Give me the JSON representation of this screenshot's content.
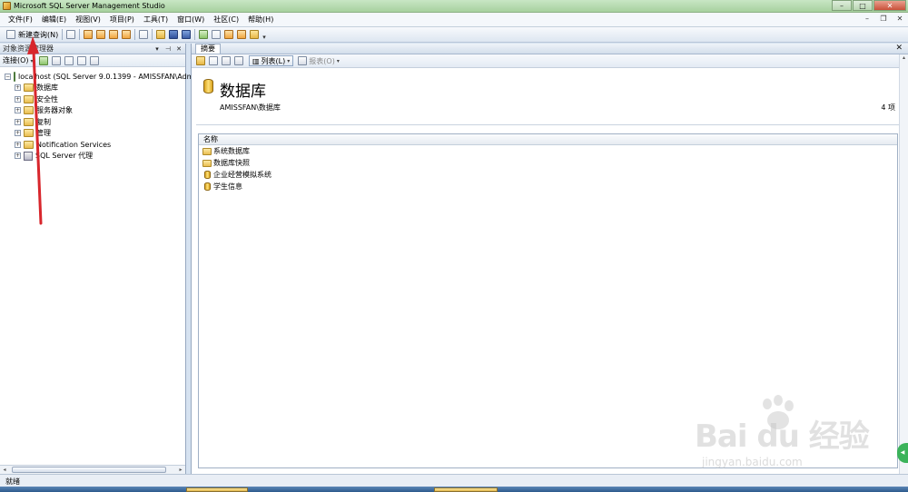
{
  "window": {
    "title": "Microsoft SQL Server Management Studio"
  },
  "menu": {
    "items": [
      "文件(F)",
      "编辑(E)",
      "视图(V)",
      "项目(P)",
      "工具(T)",
      "窗口(W)",
      "社区(C)",
      "帮助(H)"
    ]
  },
  "toolbar": {
    "new_query_label": "新建查询(N)"
  },
  "object_explorer": {
    "title": "对象资源管理器",
    "connect_label": "连接(O)",
    "root": {
      "label": "localhost (SQL Server 9.0.1399 - AMISSFAN\\Adm"
    },
    "nodes": [
      {
        "label": "数据库",
        "icon": "folder-icon"
      },
      {
        "label": "安全性",
        "icon": "folder-icon"
      },
      {
        "label": "服务器对象",
        "icon": "folder-icon"
      },
      {
        "label": "复制",
        "icon": "folder-icon"
      },
      {
        "label": "管理",
        "icon": "folder-icon"
      },
      {
        "label": "Notification Services",
        "icon": "folder-icon"
      },
      {
        "label": "SQL Server 代理",
        "icon": "agent-icon"
      }
    ]
  },
  "summary": {
    "tab_label": "摘要",
    "list_button": "列表(L)",
    "report_button": "报表(O)",
    "title": "数据库",
    "path": "AMISSFAN\\数据库",
    "count": "4 项",
    "column_header": "名称",
    "items": [
      {
        "label": "系统数据库",
        "icon": "folder-icon"
      },
      {
        "label": "数据库快照",
        "icon": "folder-icon"
      },
      {
        "label": "企业经营模拟系统",
        "icon": "database-icon"
      },
      {
        "label": "学生信息",
        "icon": "database-icon"
      }
    ]
  },
  "status": {
    "text": "就绪"
  },
  "watermark": {
    "brand": "Bai du 经验",
    "url": "jingyan.baidu.com"
  },
  "colors": {
    "titlebar": "#a7d19f",
    "annotation_arrow": "#d8262c",
    "selection_border": "#8ea6c4"
  }
}
